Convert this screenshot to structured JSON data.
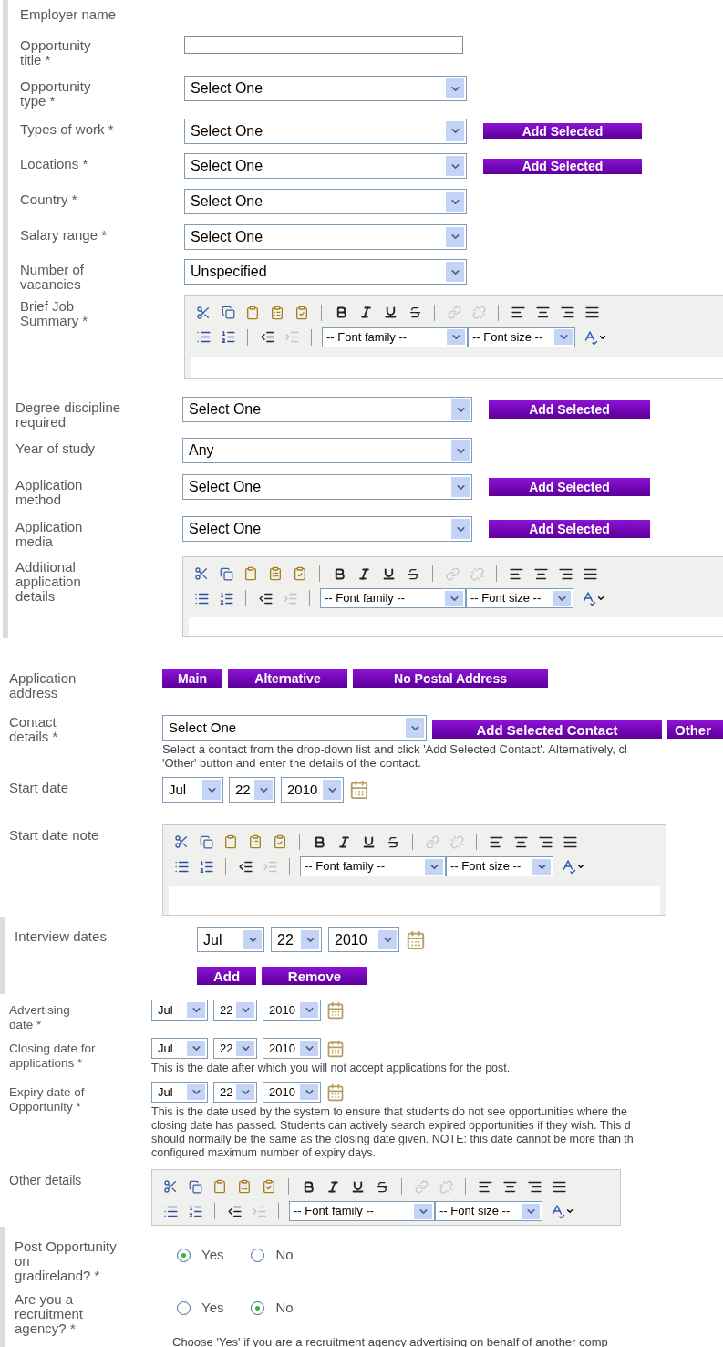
{
  "sections": [
    {
      "rows": [
        {
          "kind": "label_only",
          "label": "Employer name"
        },
        {
          "kind": "input",
          "label": "Opportunity\ntitle *"
        },
        {
          "kind": "select",
          "label": "Opportunity\ntype *",
          "value": "Select One"
        },
        {
          "kind": "select",
          "label": "Types of work *",
          "value": "Select One",
          "button": "Add Selected"
        },
        {
          "kind": "select",
          "label": "Locations *",
          "value": "Select One",
          "button": "Add Selected"
        },
        {
          "kind": "select",
          "label": "Country *",
          "value": "Select One"
        },
        {
          "kind": "select",
          "label": "Salary range *",
          "value": "Select One"
        },
        {
          "kind": "select",
          "label": "Number of\nvacancies",
          "value": "Unspecified"
        },
        {
          "kind": "editor",
          "label": "Brief Job\nSummary *",
          "font_family": "-- Font family --",
          "font_size": "-- Font size --"
        }
      ]
    },
    {
      "rows": [
        {
          "kind": "select",
          "label": "Degree discipline\nrequired",
          "value": "Select One",
          "button": "Add Selected"
        },
        {
          "kind": "select",
          "label": "Year of study",
          "value": "Any"
        },
        {
          "kind": "select",
          "label": "Application\nmethod",
          "value": "Select One",
          "button": "Add Selected"
        },
        {
          "kind": "select",
          "label": "Application\nmedia",
          "value": "Select One",
          "button": "Add Selected"
        },
        {
          "kind": "editor",
          "label": "Additional\napplication\ndetails",
          "font_family": "-- Font family --",
          "font_size": "-- Font size --"
        }
      ]
    },
    {
      "rows": [
        {
          "kind": "buttons",
          "label": "Application\naddress",
          "buttons": [
            "Main",
            "Alternative",
            "No Postal Address"
          ]
        },
        {
          "kind": "contact",
          "label": "Contact\ndetails *",
          "value": "Select One",
          "buttons": [
            "Add Selected Contact",
            "Other"
          ],
          "help_lines": [
            "Select a contact from the drop-down list and click 'Add Selected Contact'. Alternatively, cl",
            "'Other' button and enter the details of the contact."
          ]
        },
        {
          "kind": "date",
          "label": "Start date",
          "month": "Jul",
          "day": "22",
          "year": "2010"
        }
      ]
    },
    {
      "rows": [
        {
          "kind": "editor",
          "label": "Start date note",
          "font_family": "-- Font family --",
          "font_size": "-- Font size --"
        }
      ]
    },
    {
      "rows": [
        {
          "kind": "interview",
          "label": "Interview dates",
          "month": "Jul",
          "day": "22",
          "year": "2010",
          "buttons": [
            "Add",
            "Remove"
          ]
        }
      ]
    },
    {
      "rows": [
        {
          "kind": "date",
          "label": "Advertising\ndate *",
          "month": "Jul",
          "day": "22",
          "year": "2010"
        },
        {
          "kind": "date",
          "label": "Closing date for\napplications *",
          "month": "Jul",
          "day": "22",
          "year": "2010",
          "help_lines": [
            "This is the date after which you will not accept applications for the post."
          ]
        },
        {
          "kind": "date",
          "label": "Expiry date of\nOpportunity *",
          "month": "Jul",
          "day": "22",
          "year": "2010",
          "help_lines": [
            "This is the date used by the system to ensure that students do not see opportunities where the",
            "closing date has passed. Students can actively search expired opportunities if they wish. This d",
            "should normally be the same as the closing date given. NOTE: this date cannot be more than th",
            "configured maximum number of expiry days."
          ]
        }
      ]
    },
    {
      "rows": [
        {
          "kind": "editor",
          "label": "Other details",
          "font_family": "-- Font family --",
          "font_size": "-- Font size --"
        }
      ]
    },
    {
      "rows": [
        {
          "kind": "radio",
          "label": "Post Opportunity\non\ngradireland? *",
          "options": [
            {
              "label": "Yes",
              "selected": true
            },
            {
              "label": "No",
              "selected": false
            }
          ]
        },
        {
          "kind": "radio",
          "label": "Are you a\nrecruitment\nagency? *",
          "options": [
            {
              "label": "Yes",
              "selected": false
            },
            {
              "label": "No",
              "selected": true
            }
          ],
          "help_lines": [
            "Choose 'Yes' if you are a recruitment agency advertising on behalf of another comp"
          ]
        }
      ]
    }
  ]
}
